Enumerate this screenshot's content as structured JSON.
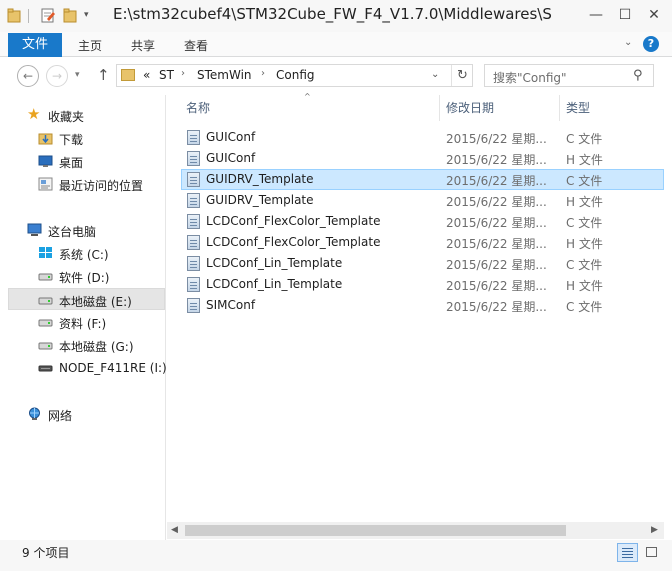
{
  "window": {
    "title": "E:\\stm32cubef4\\STM32Cube_FW_F4_V1.7.0\\Middlewares\\S...",
    "minimize_glyph": "—",
    "maximize_glyph": "☐",
    "close_glyph": "✕"
  },
  "ribbon": {
    "file_tab": "文件",
    "tabs": [
      "主页",
      "共享",
      "查看"
    ]
  },
  "nav": {
    "back_glyph": "←",
    "forward_glyph": "→",
    "up_glyph": "↑",
    "breadcrumb": {
      "overflow": "«",
      "items": [
        "ST",
        "STemWin",
        "Config"
      ]
    },
    "search_placeholder": "搜索\"Config\""
  },
  "sidebar": {
    "groups": [
      {
        "label": "收藏夹",
        "icon": "star-icon",
        "items": [
          {
            "label": "下载",
            "icon": "download-folder-icon"
          },
          {
            "label": "桌面",
            "icon": "desktop-icon"
          },
          {
            "label": "最近访问的位置",
            "icon": "recent-places-icon"
          }
        ]
      },
      {
        "label": "这台电脑",
        "icon": "computer-icon",
        "items": [
          {
            "label": "系统 (C:)",
            "icon": "windows-drive-icon"
          },
          {
            "label": "软件 (D:)",
            "icon": "drive-icon"
          },
          {
            "label": "本地磁盘 (E:)",
            "icon": "drive-icon",
            "selected": true
          },
          {
            "label": "资料 (F:)",
            "icon": "drive-icon"
          },
          {
            "label": "本地磁盘 (G:)",
            "icon": "drive-icon"
          },
          {
            "label": "NODE_F411RE (I:)",
            "icon": "usb-drive-icon"
          }
        ]
      },
      {
        "label": "网络",
        "icon": "network-icon",
        "items": []
      }
    ]
  },
  "filelist": {
    "columns": [
      "名称",
      "修改日期",
      "类型"
    ],
    "sorted_by": "名称",
    "rows": [
      {
        "name": "GUIConf",
        "date": "2015/6/22 星期...",
        "type": "C 文件"
      },
      {
        "name": "GUIConf",
        "date": "2015/6/22 星期...",
        "type": "H 文件"
      },
      {
        "name": "GUIDRV_Template",
        "date": "2015/6/22 星期...",
        "type": "C 文件",
        "selected": true
      },
      {
        "name": "GUIDRV_Template",
        "date": "2015/6/22 星期...",
        "type": "H 文件"
      },
      {
        "name": "LCDConf_FlexColor_Template",
        "date": "2015/6/22 星期...",
        "type": "C 文件"
      },
      {
        "name": "LCDConf_FlexColor_Template",
        "date": "2015/6/22 星期...",
        "type": "H 文件"
      },
      {
        "name": "LCDConf_Lin_Template",
        "date": "2015/6/22 星期...",
        "type": "C 文件"
      },
      {
        "name": "LCDConf_Lin_Template",
        "date": "2015/6/22 星期...",
        "type": "H 文件"
      },
      {
        "name": "SIMConf",
        "date": "2015/6/22 星期...",
        "type": "C 文件"
      }
    ]
  },
  "status": {
    "item_count": "9 个项目"
  },
  "colors": {
    "accent": "#1979ca",
    "selection_bg": "#cce8ff",
    "selection_border": "#99d1ff",
    "header_text": "#4c607a"
  }
}
